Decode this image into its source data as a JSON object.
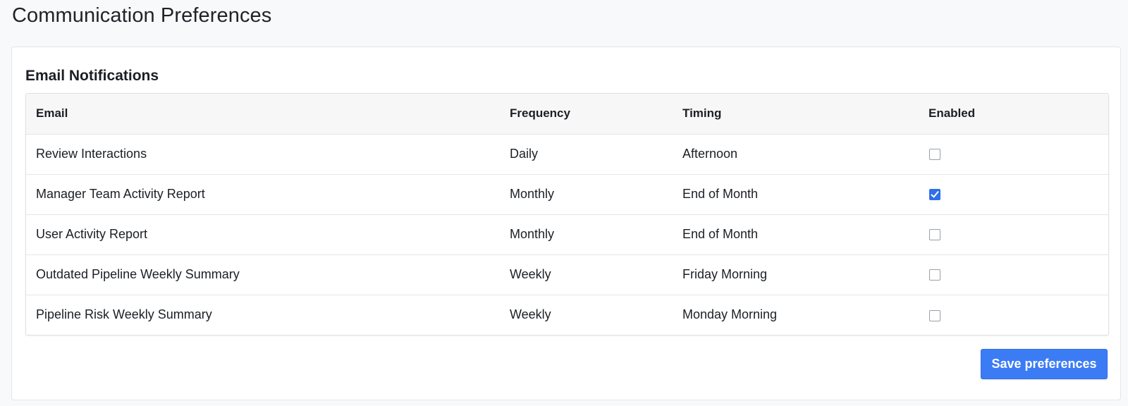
{
  "page": {
    "title": "Communication Preferences"
  },
  "section": {
    "title": "Email Notifications"
  },
  "table": {
    "headers": {
      "email": "Email",
      "frequency": "Frequency",
      "timing": "Timing",
      "enabled": "Enabled"
    },
    "rows": [
      {
        "email": "Review Interactions",
        "frequency": "Daily",
        "timing": "Afternoon",
        "enabled": false
      },
      {
        "email": "Manager Team Activity Report",
        "frequency": "Monthly",
        "timing": "End of Month",
        "enabled": true
      },
      {
        "email": "User Activity Report",
        "frequency": "Monthly",
        "timing": "End of Month",
        "enabled": false
      },
      {
        "email": "Outdated Pipeline Weekly Summary",
        "frequency": "Weekly",
        "timing": "Friday Morning",
        "enabled": false
      },
      {
        "email": "Pipeline Risk Weekly Summary",
        "frequency": "Weekly",
        "timing": "Monday Morning",
        "enabled": false
      }
    ]
  },
  "actions": {
    "save_label": "Save preferences"
  },
  "colors": {
    "accent": "#3b7cf5",
    "checkbox_checked": "#2f6fe8",
    "page_background": "#f8f9fb",
    "header_background": "#f7f7f8"
  },
  "icons": {
    "checked": "checkbox-checked-icon",
    "unchecked": "checkbox-unchecked-icon"
  }
}
